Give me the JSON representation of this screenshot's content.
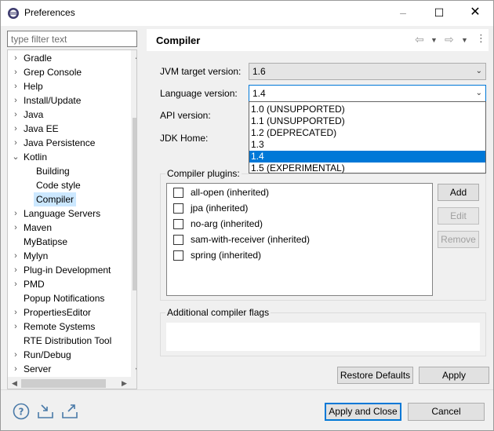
{
  "window": {
    "title": "Preferences",
    "minimize": "–",
    "maximize": "☐",
    "close": "✕"
  },
  "filter": {
    "placeholder": "type filter text"
  },
  "tree": {
    "items": [
      {
        "label": "Gradle",
        "arrow": "›",
        "level": 0
      },
      {
        "label": "Grep Console",
        "arrow": "›",
        "level": 0
      },
      {
        "label": "Help",
        "arrow": "›",
        "level": 0
      },
      {
        "label": "Install/Update",
        "arrow": "›",
        "level": 0
      },
      {
        "label": "Java",
        "arrow": "›",
        "level": 0
      },
      {
        "label": "Java EE",
        "arrow": "›",
        "level": 0
      },
      {
        "label": "Java Persistence",
        "arrow": "›",
        "level": 0
      },
      {
        "label": "Kotlin",
        "arrow": "⌄",
        "level": 0
      },
      {
        "label": "Building",
        "arrow": "",
        "level": 1
      },
      {
        "label": "Code style",
        "arrow": "",
        "level": 1
      },
      {
        "label": "Compiler",
        "arrow": "",
        "level": 1
      },
      {
        "label": "Language Servers",
        "arrow": "›",
        "level": 0
      },
      {
        "label": "Maven",
        "arrow": "›",
        "level": 0
      },
      {
        "label": "MyBatipse",
        "arrow": "",
        "level": 0
      },
      {
        "label": "Mylyn",
        "arrow": "›",
        "level": 0
      },
      {
        "label": "Plug-in Development",
        "arrow": "›",
        "level": 0
      },
      {
        "label": "PMD",
        "arrow": "›",
        "level": 0
      },
      {
        "label": "Popup Notifications",
        "arrow": "",
        "level": 0
      },
      {
        "label": "PropertiesEditor",
        "arrow": "›",
        "level": 0
      },
      {
        "label": "Remote Systems",
        "arrow": "›",
        "level": 0
      },
      {
        "label": "RTE Distribution Tool",
        "arrow": "",
        "level": 0
      },
      {
        "label": "Run/Debug",
        "arrow": "›",
        "level": 0
      },
      {
        "label": "Server",
        "arrow": "›",
        "level": 0
      }
    ],
    "selected": "Compiler"
  },
  "page": {
    "title": "Compiler",
    "jvm_label": "JVM target version:",
    "jvm_value": "1.6",
    "lang_label": "Language version:",
    "lang_value": "1.4",
    "api_label": "API version:",
    "jdk_label": "JDK Home:",
    "lang_options": [
      "1.0 (UNSUPPORTED)",
      "1.1 (UNSUPPORTED)",
      "1.2 (DEPRECATED)",
      "1.3",
      "1.4",
      "1.5 (EXPERIMENTAL)"
    ],
    "lang_selected_index": 4,
    "plugins_title": "Compiler plugins:",
    "plugins": [
      "all-open (inherited)",
      "jpa (inherited)",
      "no-arg (inherited)",
      "sam-with-receiver (inherited)",
      "spring (inherited)"
    ],
    "add_label": "Add",
    "edit_label": "Edit",
    "remove_label": "Remove",
    "flags_title": "Additional compiler flags",
    "restore_label": "Restore Defaults",
    "apply_label": "Apply"
  },
  "footer": {
    "apply_close_label": "Apply and Close",
    "cancel_label": "Cancel"
  },
  "icons": {
    "help": "help-icon",
    "import": "import-icon",
    "export": "export-icon"
  }
}
